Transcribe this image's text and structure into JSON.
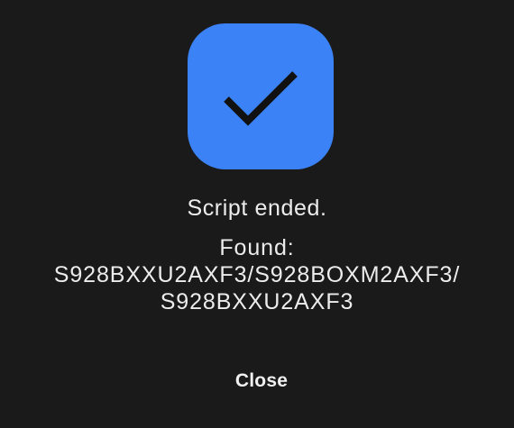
{
  "theme": {
    "background": "#1a1a1a",
    "accent": "#3b82f6",
    "checkmark": "#111111",
    "text": "#ececec"
  },
  "dialog": {
    "icon": "checkmark-icon",
    "status": "Script ended.",
    "found_label": "Found:",
    "found_lines": [
      "S928BXXU2AXF3/S928BOXM2AXF3/",
      "S928BXXU2AXF3"
    ],
    "close_label": "Close"
  }
}
